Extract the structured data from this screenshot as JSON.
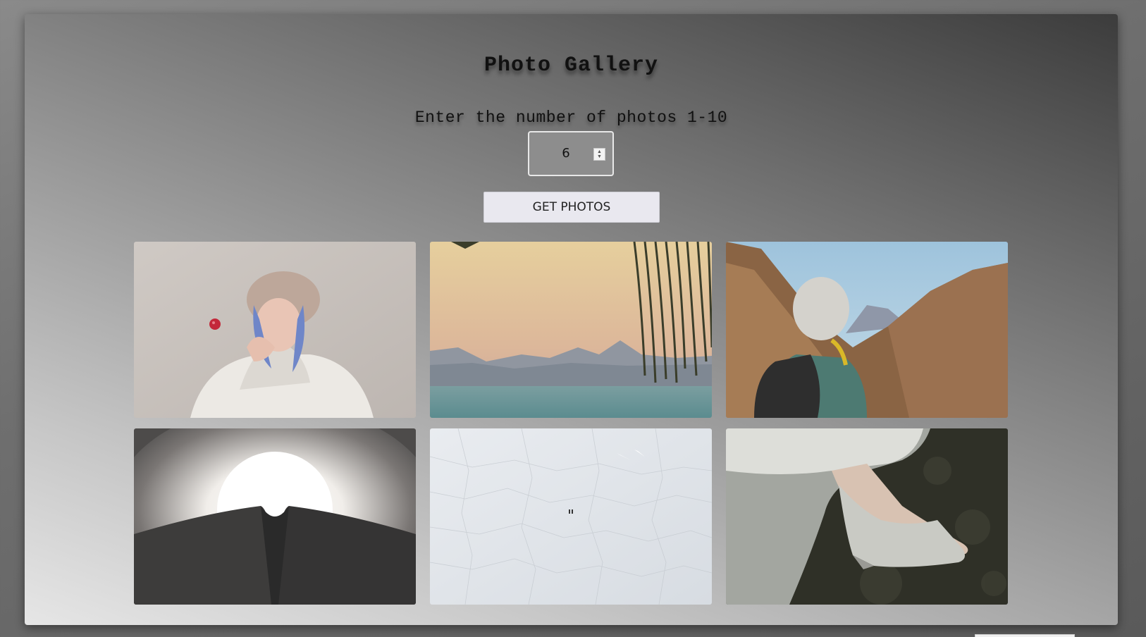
{
  "app": {
    "title": "Photo Gallery",
    "prompt": "Enter the number of photos 1-10"
  },
  "number_input": {
    "value": "6",
    "min": 1,
    "max": 10
  },
  "get_button": {
    "label": "GET PHOTOS"
  },
  "photos": [
    {
      "subject": "woman-in-fur-hat-with-red-ball"
    },
    {
      "subject": "sunset-lake-with-palm-fronds"
    },
    {
      "subject": "hiker-in-desert-mountains"
    },
    {
      "subject": "tunnel-with-bright-light"
    },
    {
      "subject": "salt-flat-aerial"
    },
    {
      "subject": "white-high-heel-shoe"
    }
  ],
  "colors": {
    "button_bg": "#e9e8ef",
    "input_border": "#e8e8e8"
  },
  "icons": {
    "spinner": "stepper-arrows-icon"
  }
}
